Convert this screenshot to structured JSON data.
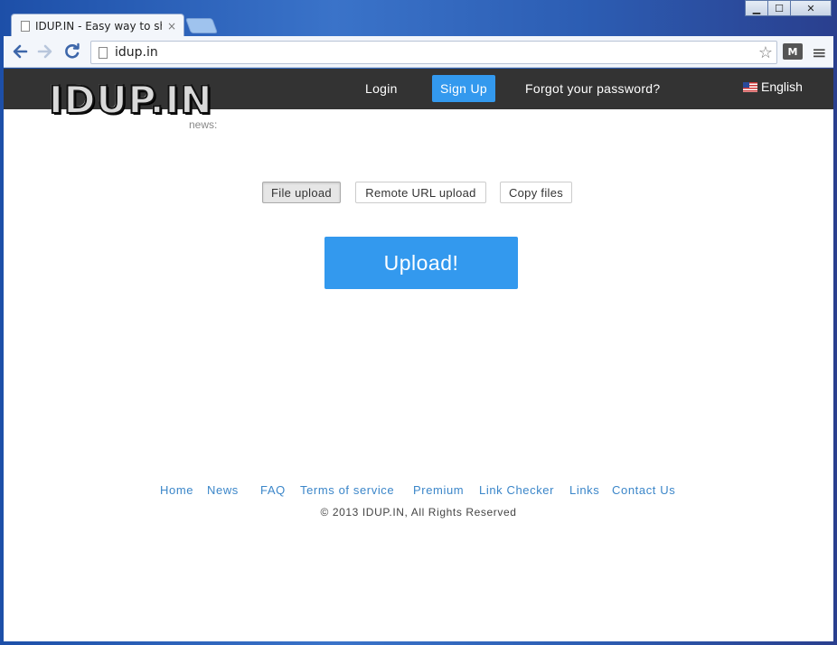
{
  "browser": {
    "tab_title": "IDUP.IN - Easy way to shar",
    "tab_close": "×",
    "url": "idup.in",
    "window_controls": {
      "minimize": "▁",
      "maximize": "☐",
      "close": "✕"
    },
    "icons": {
      "back": "back-arrow-icon",
      "forward": "forward-arrow-icon",
      "reload": "reload-icon",
      "star": "bookmark-star-icon",
      "extension": "gmail-extension-icon",
      "menu": "hamburger-menu-icon"
    },
    "extension_label": "M"
  },
  "header": {
    "logo": "IDUP.IN",
    "news_fragment": "news:",
    "login": "Login",
    "signup": "Sign Up",
    "forgot": "Forgot your password?",
    "language": "English",
    "colors": {
      "bar": "#333333",
      "accent": "#3399ee"
    }
  },
  "upload": {
    "modes": [
      "File upload",
      "Remote URL upload",
      "Copy files"
    ],
    "active_mode": "File upload",
    "button": "Upload!"
  },
  "footer": {
    "links": [
      "Home",
      "News",
      "FAQ",
      "Terms of service",
      "Premium",
      "Link Checker",
      "Links",
      "Contact Us"
    ],
    "copyright": "© 2013 IDUP.IN, All Rights Reserved",
    "link_color": "#3b86c9"
  }
}
